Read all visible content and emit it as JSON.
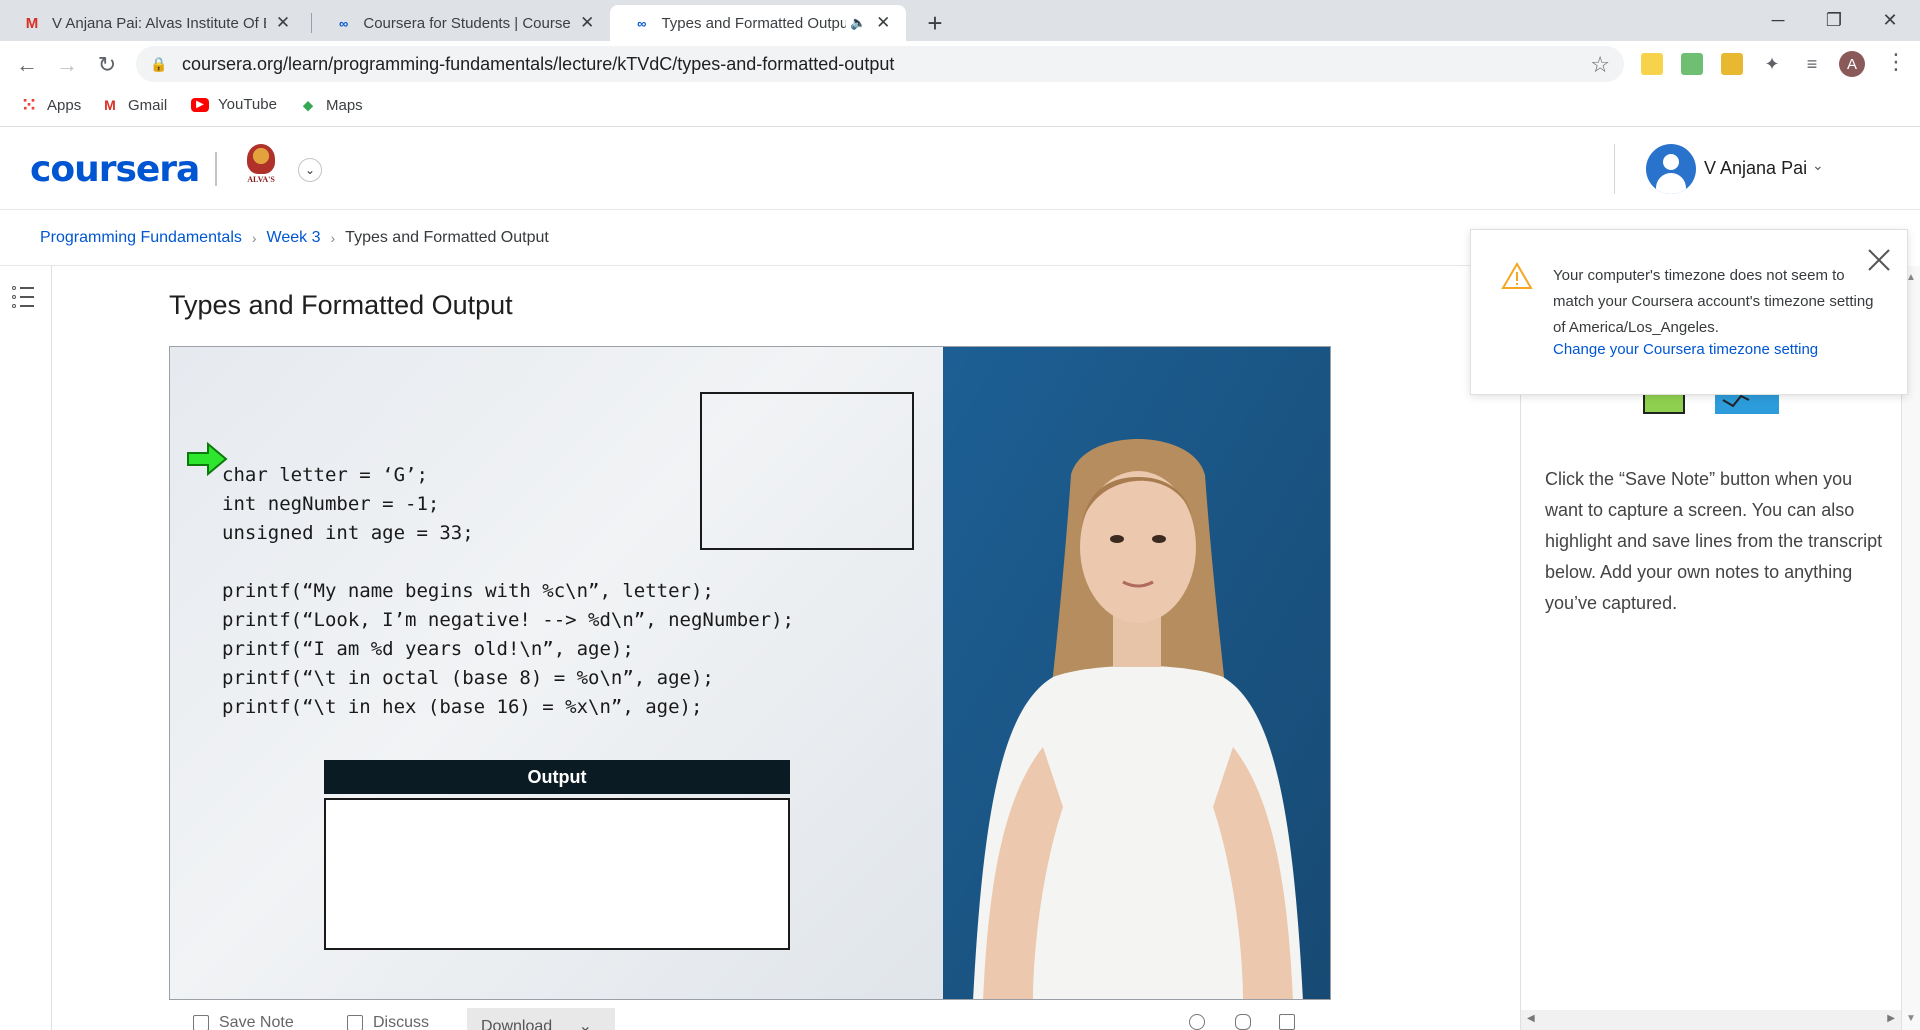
{
  "browser": {
    "tabs": [
      {
        "title": "V Anjana Pai: Alvas Institute Of Er",
        "favicon": "gmail-icon"
      },
      {
        "title": "Coursera for Students | Coursera",
        "favicon": "coursera-icon"
      },
      {
        "title": "Types and Formatted Output",
        "favicon": "coursera-icon",
        "audio": true
      }
    ],
    "url": "coursera.org/learn/programming-fundamentals/lecture/kTVdC/types-and-formatted-output",
    "profile_initial": "A",
    "bookmarks": [
      {
        "label": "Apps",
        "icon": "apps-grid-icon"
      },
      {
        "label": "Gmail",
        "icon": "gmail-icon"
      },
      {
        "label": "YouTube",
        "icon": "youtube-icon"
      },
      {
        "label": "Maps",
        "icon": "maps-icon"
      }
    ]
  },
  "header": {
    "logo": "coursera",
    "org_logo_text": "ALVA'S",
    "user_name": "V Anjana Pai"
  },
  "breadcrumb": {
    "course": "Programming Fundamentals",
    "week": "Week 3",
    "current": "Types and Formatted Output"
  },
  "lecture": {
    "title": "Types and Formatted Output",
    "slide": {
      "code": "char letter = ‘G’;\nint negNumber = -1;\nunsigned int age = 33;\n\nprintf(“My name begins with %c\\n”, letter);\nprintf(“Look, I’m negative! --> %d\\n”, negNumber);\nprintf(“I am %d years old!\\n”, age);\nprintf(“\\t in octal (base 8) = %o\\n”, age);\nprintf(“\\t in hex (base 16) = %x\\n”, age);",
      "output_label": "Output"
    }
  },
  "video_toolbar": {
    "save_note": "Save Note",
    "discuss": "Discuss",
    "download": "Download"
  },
  "notes_panel": {
    "instructions": "Click the “Save Note” button when you want to capture a screen. You can also highlight and save lines from the transcript below. Add your own notes to anything you’ve captured."
  },
  "toast": {
    "message": "Your computer's timezone does not seem to match your Coursera account's timezone setting of America/Los_Angeles.",
    "link": "Change your Coursera timezone setting"
  },
  "colors": {
    "brand": "#0056d2",
    "slide_bg": "#e6eaef",
    "presenter_bg": "#1c5a8c",
    "warning": "#f5a623"
  }
}
